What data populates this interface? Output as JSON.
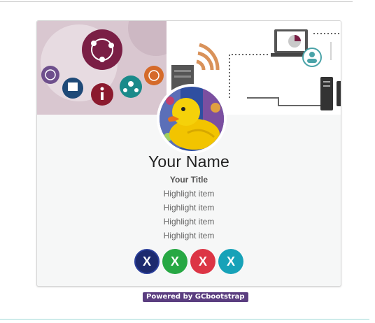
{
  "profile": {
    "name": "Your Name",
    "title": "Your Title",
    "highlights": [
      "Highlight item",
      "Highlight item",
      "Highlight item",
      "Highlight item"
    ]
  },
  "social": [
    {
      "label": "X",
      "color": "#1c2a6e",
      "icon": "x-icon"
    },
    {
      "label": "X",
      "color": "#27a844",
      "icon": "x-icon"
    },
    {
      "label": "X",
      "color": "#dc3545",
      "icon": "x-icon"
    },
    {
      "label": "X",
      "color": "#17a2b8",
      "icon": "x-icon"
    }
  ],
  "footer": {
    "powered_by": "Powered by GCbootstrap"
  },
  "colors": {
    "accent_magenta": "#7a1f45",
    "badge": "#5b3e80"
  }
}
